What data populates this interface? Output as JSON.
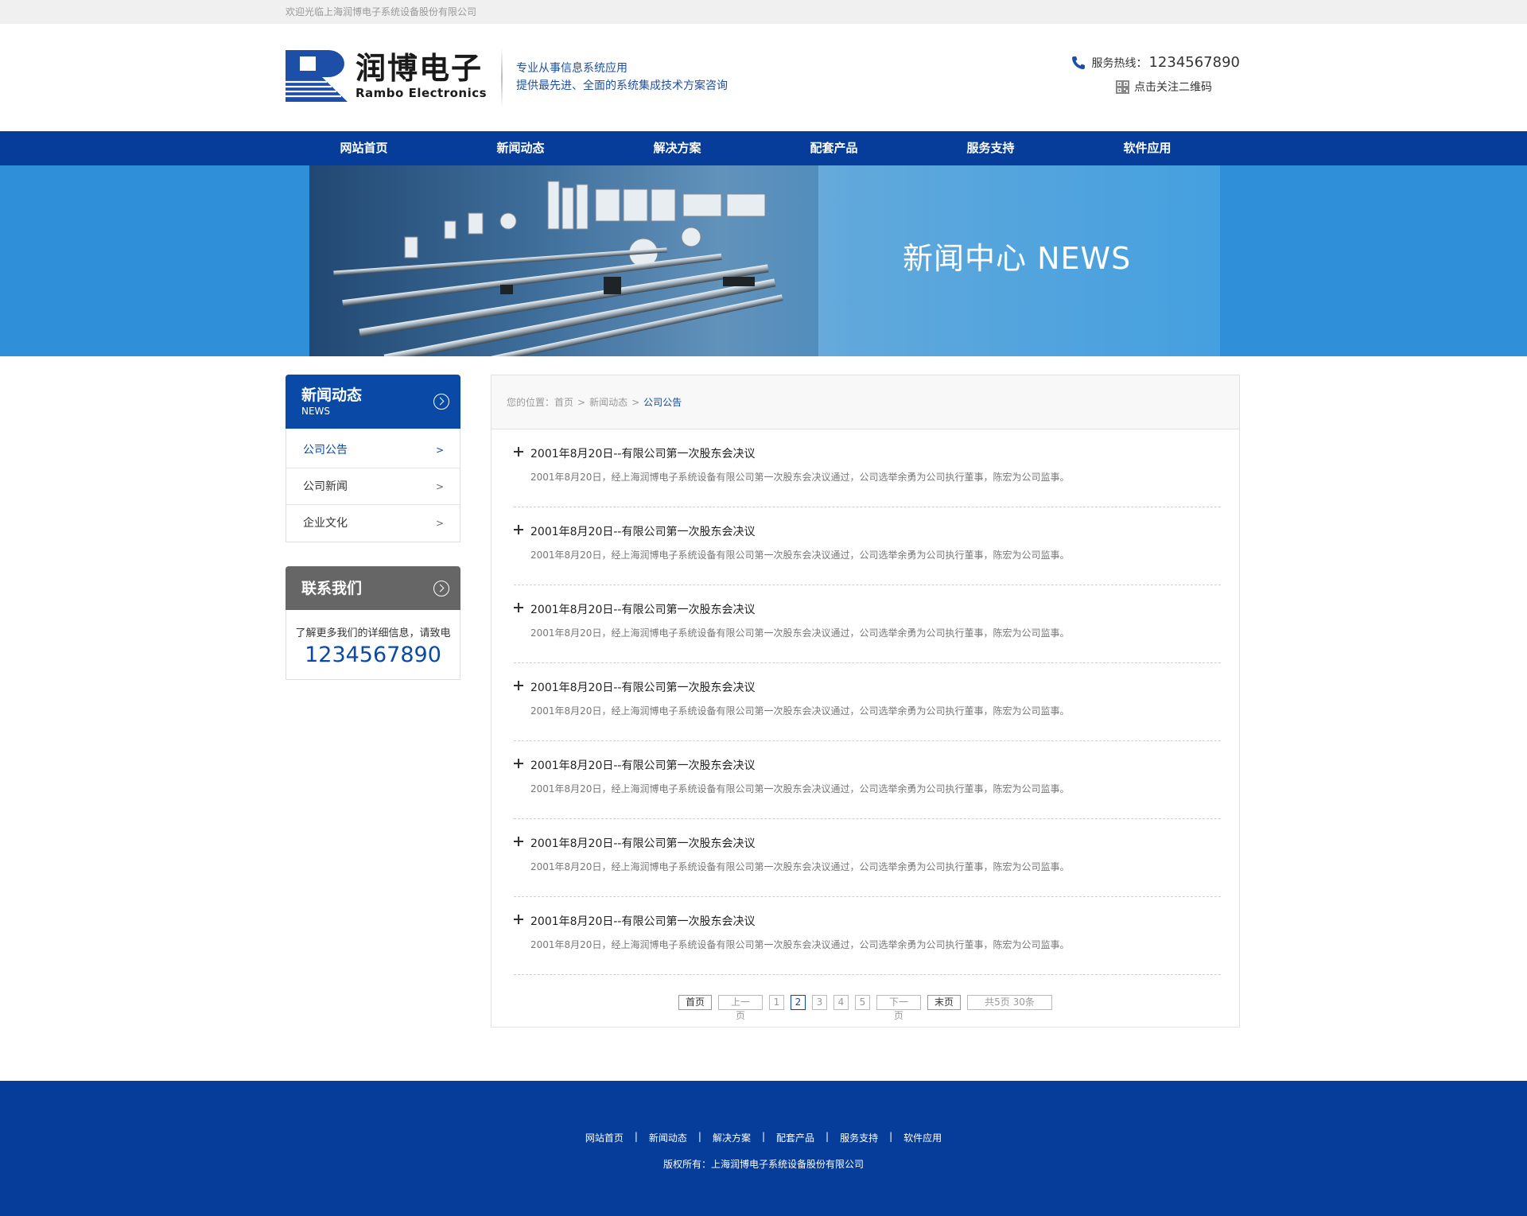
{
  "topbar": {
    "welcome": "欢迎光临上海润博电子系统设备股份有限公司"
  },
  "header": {
    "logo_cn": "润博电子",
    "logo_en": "Rambo Electronics",
    "slogan_line1": "专业从事信息系统应用",
    "slogan_line2": "提供最先进、全面的系统集成技术方案咨询",
    "hotline_label": "服务热线：",
    "hotline_number": "1234567890",
    "qr_label": "点击关注二维码"
  },
  "nav": {
    "items": [
      {
        "label": "网站首页"
      },
      {
        "label": "新闻动态"
      },
      {
        "label": "解决方案"
      },
      {
        "label": "配套产品"
      },
      {
        "label": "服务支持"
      },
      {
        "label": "软件应用"
      }
    ]
  },
  "banner": {
    "title": "新闻中心 NEWS"
  },
  "sidebar": {
    "title": "新闻动态",
    "subtitle": "NEWS",
    "items": [
      {
        "label": "公司公告",
        "arrow": ">"
      },
      {
        "label": "公司新闻",
        "arrow": ">"
      },
      {
        "label": "企业文化",
        "arrow": ">"
      }
    ],
    "contact_title": "联系我们",
    "contact_tip": "了解更多我们的详细信息，请致电",
    "contact_tel": "1234567890"
  },
  "breadcrumb": {
    "prefix": "您的位置：",
    "home": "首页",
    "sep": ">",
    "level1": "新闻动态",
    "current": "公司公告"
  },
  "news": [
    {
      "title": "2001年8月20日--有限公司第一次股东会决议",
      "desc": "2001年8月20日，经上海润博电子系统设备有限公司第一次股东会决议通过，公司选举余勇为公司执行董事，陈宏为公司监事。"
    },
    {
      "title": "2001年8月20日--有限公司第一次股东会决议",
      "desc": "2001年8月20日，经上海润博电子系统设备有限公司第一次股东会决议通过，公司选举余勇为公司执行董事，陈宏为公司监事。"
    },
    {
      "title": "2001年8月20日--有限公司第一次股东会决议",
      "desc": "2001年8月20日，经上海润博电子系统设备有限公司第一次股东会决议通过，公司选举余勇为公司执行董事，陈宏为公司监事。"
    },
    {
      "title": "2001年8月20日--有限公司第一次股东会决议",
      "desc": "2001年8月20日，经上海润博电子系统设备有限公司第一次股东会决议通过，公司选举余勇为公司执行董事，陈宏为公司监事。"
    },
    {
      "title": "2001年8月20日--有限公司第一次股东会决议",
      "desc": "2001年8月20日，经上海润博电子系统设备有限公司第一次股东会决议通过，公司选举余勇为公司执行董事，陈宏为公司监事。"
    },
    {
      "title": "2001年8月20日--有限公司第一次股东会决议",
      "desc": "2001年8月20日，经上海润博电子系统设备有限公司第一次股东会决议通过，公司选举余勇为公司执行董事，陈宏为公司监事。"
    },
    {
      "title": "2001年8月20日--有限公司第一次股东会决议",
      "desc": "2001年8月20日，经上海润博电子系统设备有限公司第一次股东会决议通过，公司选举余勇为公司执行董事，陈宏为公司监事。"
    }
  ],
  "pager": {
    "first": "首页",
    "prev": "上一页",
    "pages": [
      "1",
      "2",
      "3",
      "4",
      "5"
    ],
    "current_page": "2",
    "next": "下一页",
    "last": "末页",
    "total": "共5页 30条"
  },
  "footer": {
    "links": [
      "网站首页",
      "新闻动态",
      "解决方案",
      "配套产品",
      "服务支持",
      "软件应用"
    ],
    "separator": "|",
    "copyright": "版权所有：上海润博电子系统设备股份有限公司"
  },
  "colors": {
    "brand_blue": "#073d9a",
    "accent_blue": "#0a4aa6",
    "banner_blue": "#2f8fd8",
    "sidebar_gray": "#666666"
  }
}
